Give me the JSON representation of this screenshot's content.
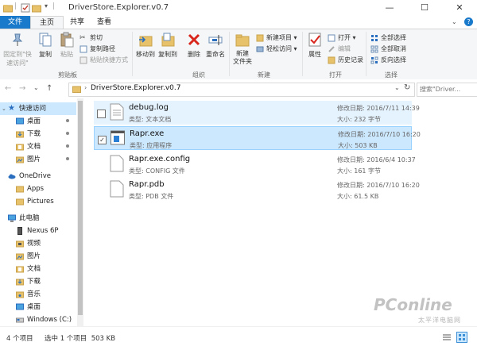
{
  "window": {
    "title": "DriverStore.Explorer.v0.7",
    "minimize": "—",
    "maximize": "☐",
    "close": "✕"
  },
  "tabs": {
    "file": "文件",
    "home": "主页",
    "share": "共享",
    "view": "查看"
  },
  "ribbon": {
    "pin_quick": "固定到\"快速访问\"",
    "copy": "复制",
    "paste": "粘贴",
    "cut": "剪切",
    "copy_path": "复制路径",
    "paste_shortcut": "粘贴快捷方式",
    "group_clipboard": "剪贴板",
    "move_to": "移动到",
    "copy_to": "复制到",
    "delete": "删除",
    "rename": "重命名",
    "group_organize": "组织",
    "new_folder": "新建\n文件夹",
    "new_item": "新建项目",
    "easy_access": "轻松访问",
    "group_new": "新建",
    "properties": "属性",
    "open": "打开",
    "edit": "编辑",
    "history": "历史记录",
    "group_open": "打开",
    "select_all": "全部选择",
    "select_none": "全部取消",
    "invert": "反向选择",
    "group_select": "选择"
  },
  "address": {
    "path": "DriverStore.Explorer.v0.7",
    "search_placeholder": "搜索\"Driver...",
    "back": "←",
    "forward": "→",
    "up": "↑",
    "refresh": "↻"
  },
  "nav": {
    "quick_access": "快速访问",
    "desktop": "桌面",
    "downloads": "下载",
    "documents": "文档",
    "pictures": "图片",
    "onedrive": "OneDrive",
    "apps": "Apps",
    "pictures_en": "Pictures",
    "this_pc": "此电脑",
    "nexus": "Nexus 6P",
    "videos": "视频",
    "pc_pictures": "图片",
    "pc_documents": "文档",
    "pc_downloads": "下载",
    "music": "音乐",
    "pc_desktop": "桌面",
    "windows_c": "Windows (C:)"
  },
  "files": [
    {
      "name": "debug.log",
      "type": "类型: 文本文档",
      "date": "修改日期: 2016/7/11 14:39",
      "size": "大小: 232 字节"
    },
    {
      "name": "Rapr.exe",
      "type": "类型: 应用程序",
      "date": "修改日期: 2016/7/10 16:20",
      "size": "大小: 503 KB"
    },
    {
      "name": "Rapr.exe.config",
      "type": "类型: CONFIG 文件",
      "date": "修改日期: 2016/6/4 10:37",
      "size": "大小: 161 字节"
    },
    {
      "name": "Rapr.pdb",
      "type": "类型: PDB 文件",
      "date": "修改日期: 2016/7/10 16:20",
      "size": "大小: 61.5 KB"
    }
  ],
  "status": {
    "count": "4 个项目",
    "selected": "选中 1 个项目  503 KB"
  },
  "watermark": {
    "brand": "PConline",
    "sub": "太平洋电脑网"
  },
  "colors": {
    "accent": "#1979ca",
    "selection": "#cce8ff",
    "hover": "#e5f3ff",
    "folder": "#e8c26a"
  }
}
